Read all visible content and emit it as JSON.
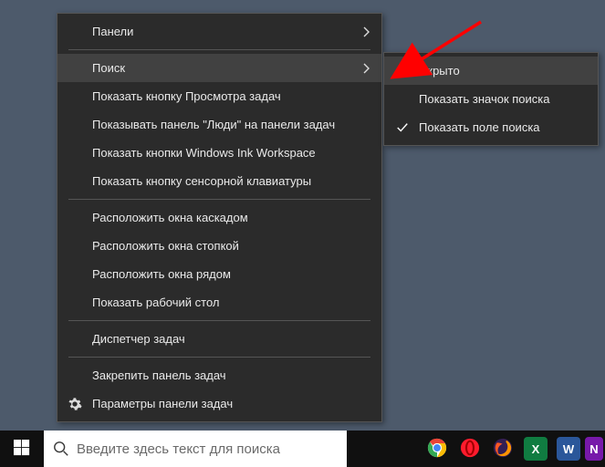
{
  "menu": {
    "panels": "Панели",
    "search": "Поиск",
    "show_taskview": "Показать кнопку Просмотра задач",
    "show_people": "Показывать панель \"Люди\" на панели задач",
    "show_ink": "Показать кнопки Windows Ink Workspace",
    "show_touchkbd": "Показать кнопку сенсорной клавиатуры",
    "cascade": "Расположить окна каскадом",
    "stacked": "Расположить окна стопкой",
    "sidebyside": "Расположить окна рядом",
    "show_desktop": "Показать рабочий стол",
    "task_manager": "Диспетчер задач",
    "lock_taskbar": "Закрепить панель задач",
    "taskbar_settings": "Параметры панели задач"
  },
  "submenu": {
    "hidden": "Скрыто",
    "show_icon": "Показать значок поиска",
    "show_field": "Показать поле поиска"
  },
  "taskbar": {
    "search_placeholder": "Введите здесь текст для поиска",
    "apps": {
      "excel": "X",
      "word": "W",
      "onenote": "N"
    }
  },
  "colors": {
    "arrow": "#ff0000",
    "excel": "#107c41",
    "word": "#2b579a",
    "onenote": "#7719aa"
  }
}
